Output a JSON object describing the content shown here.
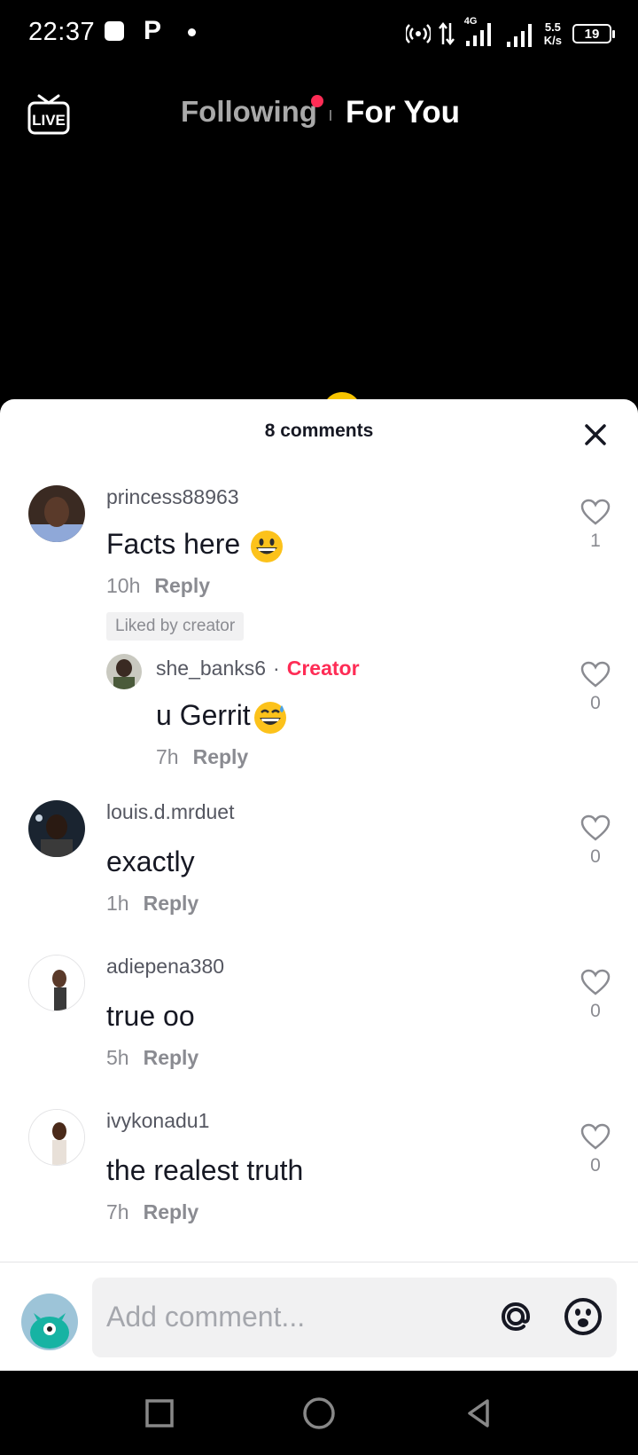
{
  "status_bar": {
    "time": "22:37",
    "app_icon": "P",
    "network": "4G",
    "speed_value": "5.5",
    "speed_unit": "K/s",
    "battery": "19"
  },
  "top_nav": {
    "live_label": "LIVE",
    "tabs": [
      {
        "label": "Following",
        "active": false
      },
      {
        "label": "For You",
        "active": true
      }
    ],
    "notification_color": "#fe2c55"
  },
  "comments_sheet": {
    "title": "8 comments",
    "comments": [
      {
        "username": "princess88963",
        "text": "Facts here",
        "emoji": "grinning-face",
        "time": "10h",
        "reply_label": "Reply",
        "likes": "1",
        "badge": "Liked by creator",
        "replies": [
          {
            "username": "she_banks6",
            "creator_label": "Creator",
            "text": "u Gerrit",
            "emoji": "grinning-sweat-face",
            "time": "7h",
            "reply_label": "Reply",
            "likes": "0"
          }
        ]
      },
      {
        "username": "louis.d.mrduet",
        "text": "exactly",
        "time": "1h",
        "reply_label": "Reply",
        "likes": "0"
      },
      {
        "username": "adiepena380",
        "text": "true oo",
        "time": "5h",
        "reply_label": "Reply",
        "likes": "0"
      },
      {
        "username": "ivykonadu1",
        "text": "the realest truth",
        "time": "7h",
        "reply_label": "Reply",
        "likes": "0"
      }
    ],
    "input": {
      "placeholder": "Add comment...",
      "icons": [
        "at-icon",
        "emoji-icon"
      ]
    }
  },
  "colors": {
    "accent": "#fe2c55",
    "text_primary": "#161823",
    "text_secondary": "#8a8b91"
  },
  "system_nav": [
    "recents-button",
    "home-button",
    "back-button"
  ]
}
